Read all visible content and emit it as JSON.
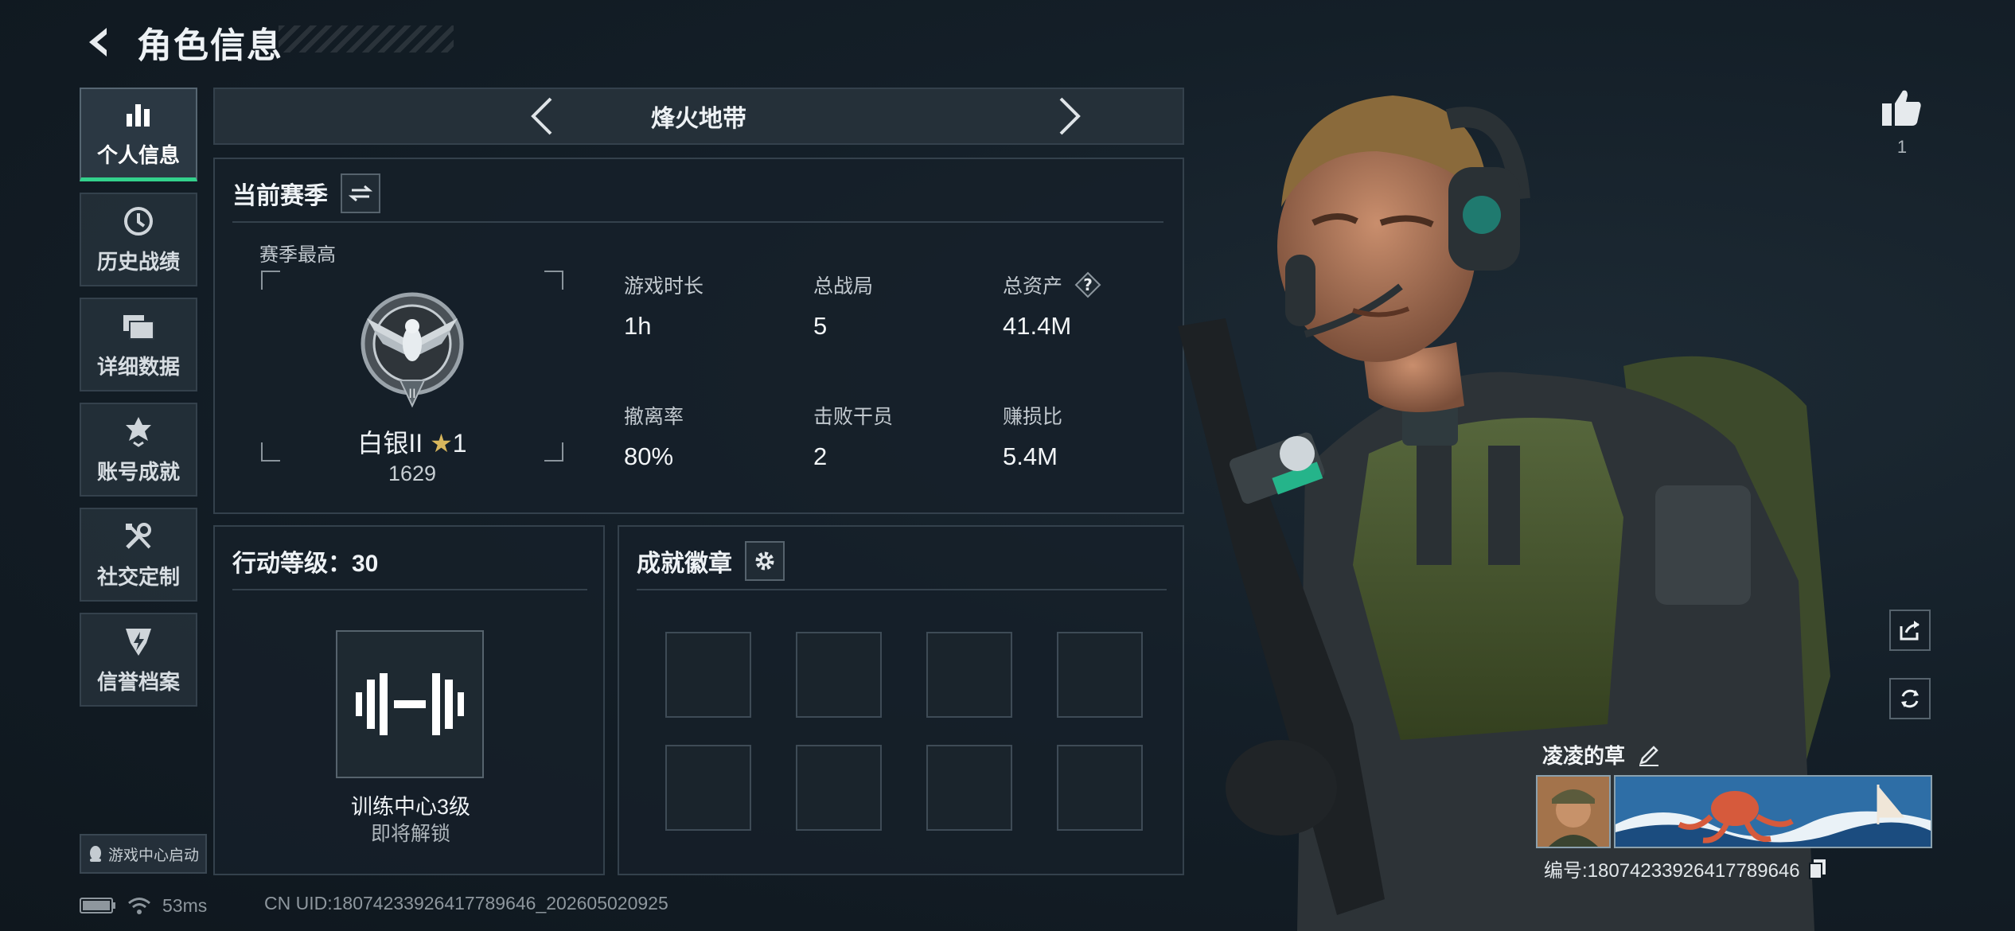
{
  "header": {
    "title": "角色信息",
    "back_icon": "back-chevron-icon"
  },
  "nav": {
    "items": [
      {
        "label": "个人信息",
        "icon": "bar-chart-icon",
        "active": true
      },
      {
        "label": "历史战绩",
        "icon": "clock-icon",
        "active": false
      },
      {
        "label": "详细数据",
        "icon": "folder-icon",
        "active": false
      },
      {
        "label": "账号成就",
        "icon": "medal-icon",
        "active": false
      },
      {
        "label": "社交定制",
        "icon": "tools-icon",
        "active": false
      },
      {
        "label": "信誉档案",
        "icon": "shield-lightning-icon",
        "active": false
      }
    ],
    "game_center_label": "游戏中心启动"
  },
  "mode": {
    "label": "烽火地带"
  },
  "season": {
    "title": "当前赛季",
    "sub_label": "赛季最高",
    "rank": {
      "name": "白银II",
      "star": "★",
      "stars": "1",
      "score": "1629"
    },
    "stats": [
      {
        "key": "游戏时长",
        "value": "1h"
      },
      {
        "key": "总战局",
        "value": "5"
      },
      {
        "key": "总资产",
        "value": "41.4M",
        "help": true
      },
      {
        "key": "撤离率",
        "value": "80%"
      },
      {
        "key": "击败干员",
        "value": "2"
      },
      {
        "key": "赚损比",
        "value": "5.4M"
      }
    ]
  },
  "level": {
    "title": "行动等级：30",
    "training_name": "训练中心3级",
    "training_status": "即将解锁"
  },
  "badges": {
    "title": "成就徽章",
    "slot_count": 8
  },
  "status_bar": {
    "ping": "53ms",
    "uid": "CN UID:18074233926417789646_202605020925"
  },
  "player": {
    "likes": "1",
    "name": "凌凌的草",
    "id_text": "编号:18074233926417789646"
  },
  "colors": {
    "accent": "#33d18c",
    "panel": "#162029",
    "border": "#34414c"
  }
}
